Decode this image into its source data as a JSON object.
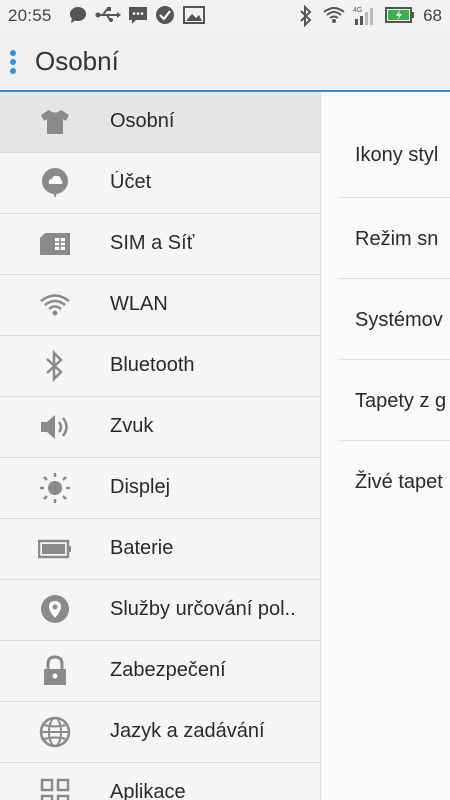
{
  "status_bar": {
    "time": "20:55",
    "battery_level": "68",
    "battery_color": "#37b24d"
  },
  "header": {
    "title": "Osobní"
  },
  "sidebar": {
    "items": [
      {
        "label": "Osobní",
        "icon": "shirt-icon",
        "selected": true
      },
      {
        "label": "Účet",
        "icon": "account-cloud-icon"
      },
      {
        "label": "SIM a Síť",
        "icon": "sim-card-icon"
      },
      {
        "label": "WLAN",
        "icon": "wifi-icon"
      },
      {
        "label": "Bluetooth",
        "icon": "bluetooth-icon"
      },
      {
        "label": "Zvuk",
        "icon": "speaker-icon"
      },
      {
        "label": "Displej",
        "icon": "brightness-icon"
      },
      {
        "label": "Baterie",
        "icon": "battery-icon"
      },
      {
        "label": "Služby určování pol..",
        "icon": "location-pin-icon"
      },
      {
        "label": "Zabezpečení",
        "icon": "lock-icon"
      },
      {
        "label": "Jazyk a zadávání",
        "icon": "globe-icon"
      },
      {
        "label": "Aplikace",
        "icon": "apps-grid-icon"
      }
    ]
  },
  "detail": {
    "items": [
      {
        "label": "Ikony styl"
      },
      {
        "label": "Režim sn"
      },
      {
        "label": "Systémov"
      },
      {
        "label": "Tapety z g"
      },
      {
        "label": "Živé tapet"
      }
    ]
  },
  "colors": {
    "accent": "#2f8ed6",
    "icon_gray": "#8a8a8a"
  }
}
